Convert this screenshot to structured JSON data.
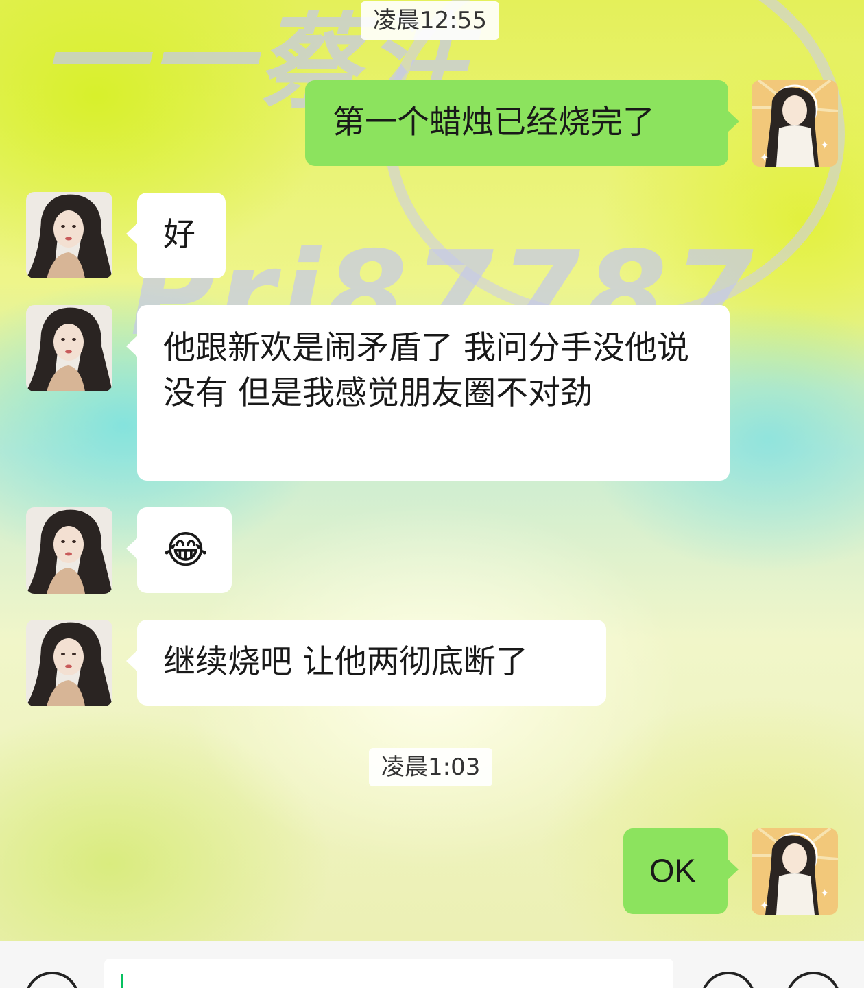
{
  "chat": {
    "messages": [
      {
        "type": "time",
        "text": "凌晨12:55"
      },
      {
        "type": "message",
        "side": "right",
        "text": "第一个蜡烛已经烧完了"
      },
      {
        "type": "message",
        "side": "left",
        "text": "好"
      },
      {
        "type": "message",
        "side": "left",
        "text": "他跟新欢是闹矛盾了 我问分手没他说没有 但是我感觉朋友圈不对劲"
      },
      {
        "type": "message",
        "side": "left",
        "text": "😂"
      },
      {
        "type": "message",
        "side": "left",
        "text": "继续烧吧 让他两彻底断了"
      },
      {
        "type": "time",
        "text": "凌晨1:03"
      },
      {
        "type": "message",
        "side": "right",
        "text": "OK"
      }
    ]
  },
  "background": {
    "watermark_top": "一一蔡注",
    "watermark_middle": "Pri87787"
  },
  "colors": {
    "self_bubble": "#8ce35e",
    "other_bubble": "#ffffff",
    "input_caret": "#07c160"
  },
  "input_bar": {
    "left_icon": "voice-icon",
    "right_icons": [
      "emoji-icon",
      "plus-icon"
    ]
  }
}
